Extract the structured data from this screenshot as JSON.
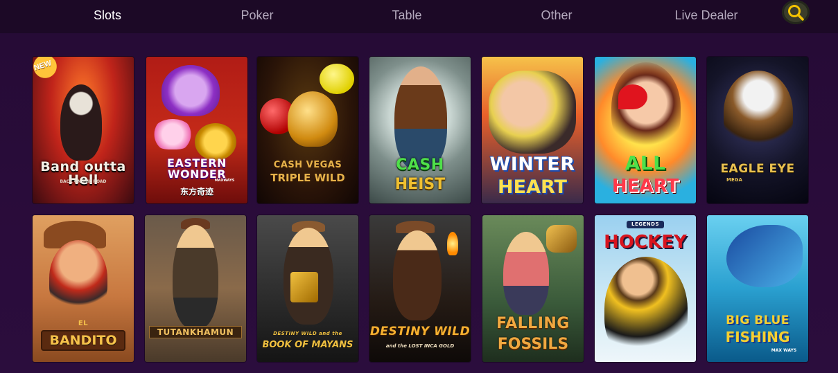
{
  "nav": {
    "tabs": [
      {
        "label": "Slots",
        "active": true
      },
      {
        "label": "Poker",
        "active": false
      },
      {
        "label": "Table",
        "active": false
      },
      {
        "label": "Other",
        "active": false
      },
      {
        "label": "Live Dealer",
        "active": false
      }
    ],
    "search_icon": "search-icon",
    "accent_color": "#f5c400"
  },
  "games": [
    {
      "title": "Band outta Hell",
      "subtitle": "BACK ON THE ROAD",
      "badge": "NEW"
    },
    {
      "title": "EASTERN WONDER",
      "subtitle": "东方奇迹",
      "extra": "MAXWAYS"
    },
    {
      "title": "CASH VEGAS",
      "subtitle": "TRIPLE WILD"
    },
    {
      "title": "CASH",
      "subtitle": "HEIST"
    },
    {
      "title": "WINTER",
      "subtitle": "HEART"
    },
    {
      "title": "ALL",
      "subtitle": "HEART"
    },
    {
      "title": "EAGLE EYE",
      "subtitle": "MEGA"
    },
    {
      "title": "EL",
      "subtitle": "BANDITO"
    },
    {
      "title": "TUTANKHAMUN",
      "subtitle": ""
    },
    {
      "title": "DESTINY WILD and the",
      "subtitle": "BOOK OF MAYANS"
    },
    {
      "title": "DESTINY WILD",
      "subtitle": "and the LOST INCA GOLD"
    },
    {
      "title": "FALLING",
      "subtitle": "FOSSILS"
    },
    {
      "title": "LEGENDS",
      "subtitle": "HOCKEY"
    },
    {
      "title": "BIG BLUE",
      "subtitle": "FISHING",
      "extra": "MAX WAYS"
    }
  ]
}
